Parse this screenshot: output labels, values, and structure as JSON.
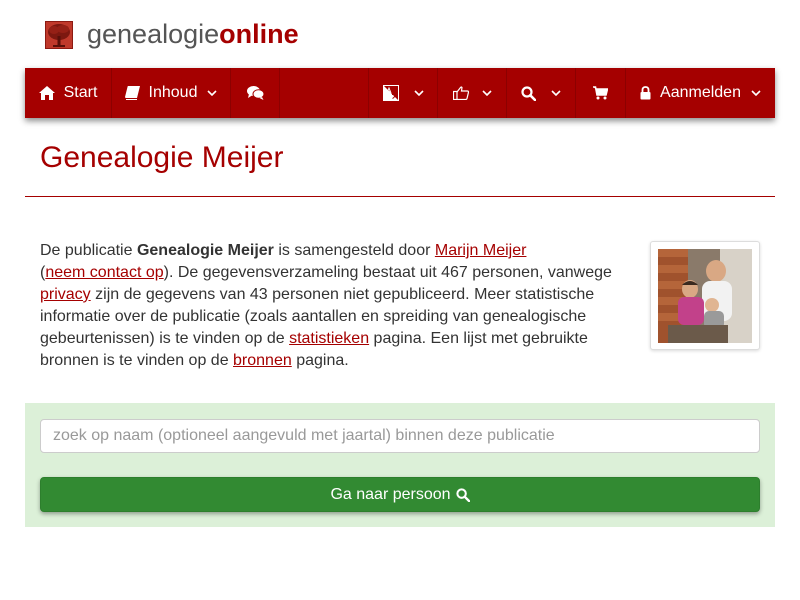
{
  "logo": {
    "part1": "genealogie",
    "part2": "online",
    "tree_icon": "tree-icon"
  },
  "nav": {
    "start": {
      "label": "Start",
      "icon": "home-icon"
    },
    "inhoud": {
      "label": "Inhoud",
      "icon": "book-icon"
    },
    "chat": {
      "icon": "comments-icon"
    },
    "language": {
      "icon": "translate-icon"
    },
    "share": {
      "icon": "thumbs-up-icon"
    },
    "search": {
      "icon": "search-icon"
    },
    "cart": {
      "icon": "cart-icon"
    },
    "login": {
      "label": "Aanmelden",
      "icon": "lock-icon"
    }
  },
  "page": {
    "title": "Genealogie Meijer"
  },
  "intro": {
    "t1": "De publicatie ",
    "pub_name": "Genealogie Meijer",
    "t2": " is samengesteld door ",
    "author_link": "Marijn Meijer",
    "t3": "(",
    "contact_link": "neem contact op",
    "t4": "). De gegevensverzameling bestaat uit 467 personen, vanwege ",
    "privacy_link": "privacy",
    "t5": " zijn de gegevens van 43 personen niet gepubliceerd. Meer statistische informatie over de publicatie (zoals aantallen en spreiding van genealogische gebeurtenissen) is te vinden op de ",
    "stats_link": "statistieken",
    "t6": " pagina. Een lijst met gebruikte bronnen is te vinden op de ",
    "sources_link": "bronnen",
    "t7": " pagina."
  },
  "search": {
    "placeholder": "zoek op naam (optioneel aangevuld met jaartal) binnen deze publicatie",
    "value": "",
    "button_label": "Ga naar persoon"
  },
  "colors": {
    "brand": "#a50000",
    "nav_bg": "#a50000",
    "panel_bg": "#dcf0d8",
    "button_bg": "#328a32"
  }
}
